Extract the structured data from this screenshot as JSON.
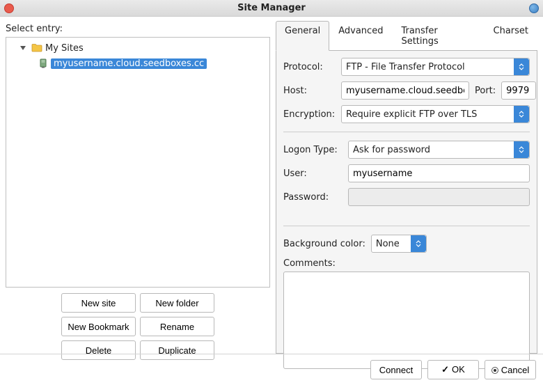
{
  "window": {
    "title": "Site Manager"
  },
  "left": {
    "select_entry_label": "Select entry:",
    "tree": {
      "root_label": "My Sites",
      "selected_site": "myusername.cloud.seedboxes.cc"
    },
    "buttons": {
      "new_site": "New site",
      "new_folder": "New folder",
      "new_bookmark": "New Bookmark",
      "rename": "Rename",
      "delete": "Delete",
      "duplicate": "Duplicate"
    }
  },
  "tabs": {
    "general": "General",
    "advanced": "Advanced",
    "transfer": "Transfer Settings",
    "charset": "Charset"
  },
  "form": {
    "protocol_label": "Protocol:",
    "protocol_value": "FTP - File Transfer Protocol",
    "host_label": "Host:",
    "host_value": "myusername.cloud.seedboxes.cc",
    "port_label": "Port:",
    "port_value": "9979",
    "encryption_label": "Encryption:",
    "encryption_value": "Require explicit FTP over TLS",
    "logon_type_label": "Logon Type:",
    "logon_type_value": "Ask for password",
    "user_label": "User:",
    "user_value": "myusername",
    "password_label": "Password:",
    "password_value": "",
    "bg_label": "Background color:",
    "bg_value": "None",
    "comments_label": "Comments:",
    "comments_value": ""
  },
  "footer": {
    "connect": "Connect",
    "ok": "OK",
    "cancel": "Cancel"
  }
}
